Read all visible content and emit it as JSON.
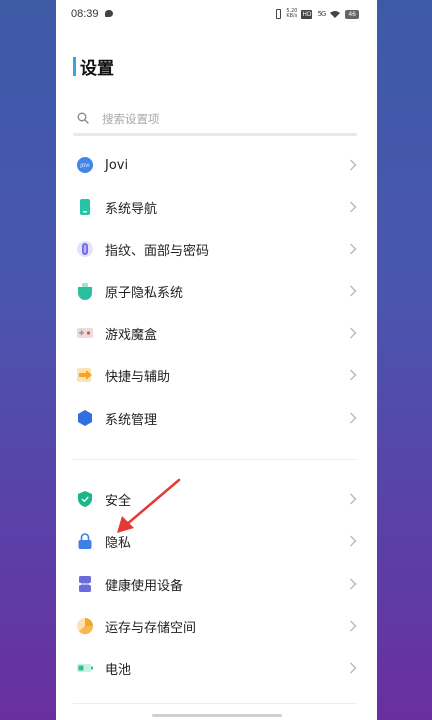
{
  "status_bar": {
    "time": "08:39",
    "speed": "5.20 KB/s",
    "hd_badge": "HD",
    "signal_label": "5G",
    "battery": "46",
    "icons": [
      "message-icon",
      "vibrate-icon",
      "wifi-icon",
      "battery-icon"
    ]
  },
  "header": {
    "title": "设置"
  },
  "search": {
    "placeholder": "搜索设置项"
  },
  "groups": [
    {
      "items": [
        {
          "label": "Jovi",
          "icon": "jovi-icon",
          "color": "#3f86e8"
        },
        {
          "label": "系统导航",
          "icon": "phone-navigation-icon",
          "color": "#27c3a8"
        },
        {
          "label": "指纹、面部与密码",
          "icon": "fingerprint-icon",
          "color": "#6f6ce8"
        },
        {
          "label": "原子隐私系统",
          "icon": "atom-privacy-icon",
          "color": "#2bbf9f"
        },
        {
          "label": "游戏魔盒",
          "icon": "game-box-icon",
          "color": "#e05050"
        },
        {
          "label": "快捷与辅助",
          "icon": "shortcut-arrow-icon",
          "color": "#f5a623"
        },
        {
          "label": "系统管理",
          "icon": "system-management-icon",
          "color": "#2f6fe0"
        }
      ]
    },
    {
      "items": [
        {
          "label": "安全",
          "icon": "shield-icon",
          "color": "#1fb58a"
        },
        {
          "label": "隐私",
          "icon": "lock-icon",
          "color": "#3f7fe6"
        },
        {
          "label": "健康使用设备",
          "icon": "hourglass-icon",
          "color": "#6b6bdc"
        },
        {
          "label": "运存与存储空间",
          "icon": "storage-pie-icon",
          "color": "#f2a72d"
        },
        {
          "label": "电池",
          "icon": "battery-icon",
          "color": "#2fc28e"
        }
      ]
    }
  ],
  "annotation": {
    "arrow_color": "#e53935"
  }
}
